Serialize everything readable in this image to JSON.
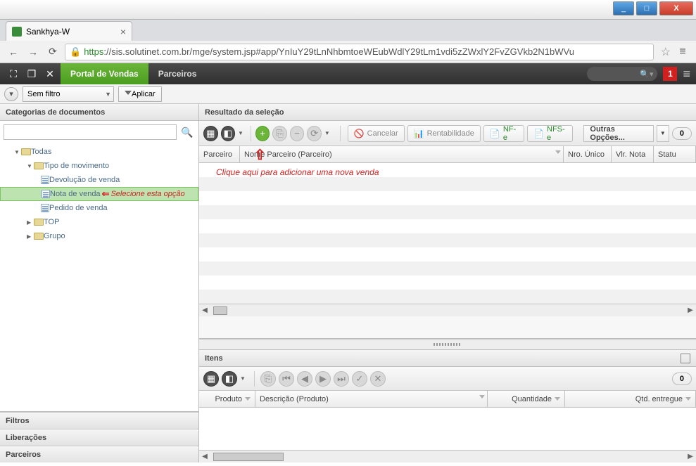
{
  "window": {
    "title_buttons": {
      "min": "_",
      "max": "□",
      "close": "X"
    }
  },
  "browser": {
    "tab_title": "Sankhya-W",
    "url_https": "https",
    "url_rest": "://sis.solutinet.com.br/mge/system.jsp#app/YnIuY29tLnNhbmtoeWEubWdlY29tLm1vdi5zZWxlY2FvZGVkb2N1bWVu"
  },
  "apptabs": {
    "active": "Portal de Vendas",
    "inactive": "Parceiros",
    "notif": "1"
  },
  "filter": {
    "selected": "Sem filtro",
    "apply": "Aplicar"
  },
  "left": {
    "header": "Categorias de documentos",
    "tree": {
      "root": "Todas",
      "tipo": "Tipo de movimento",
      "devol": "Devolução de venda",
      "nota": "Nota de venda",
      "pedido": "Pedido de venda",
      "top": "TOP",
      "grupo": "Grupo"
    },
    "annot_select": "Selecione esta opção",
    "bottom": {
      "filtros": "Filtros",
      "lib": "Liberações",
      "parc": "Parceiros"
    }
  },
  "result": {
    "header": "Resultado da seleção",
    "cancel": "Cancelar",
    "rent": "Rentabilidade",
    "nfe": "NF-e",
    "nfse": "NFS-e",
    "outras": "Outras Opções...",
    "count": "0",
    "cols": {
      "parceiro": "Parceiro",
      "nome": "Nome Parceiro (Parceiro)",
      "nro": "Nro. Único",
      "vlr": "Vlr. Nota",
      "status": "Statu"
    },
    "annot_add": "Clique aqui para adicionar uma nova venda"
  },
  "itens": {
    "header": "Itens",
    "count": "0",
    "cols": {
      "produto": "Produto",
      "desc": "Descrição (Produto)",
      "qtd": "Quantidade",
      "qtde": "Qtd. entregue"
    }
  }
}
